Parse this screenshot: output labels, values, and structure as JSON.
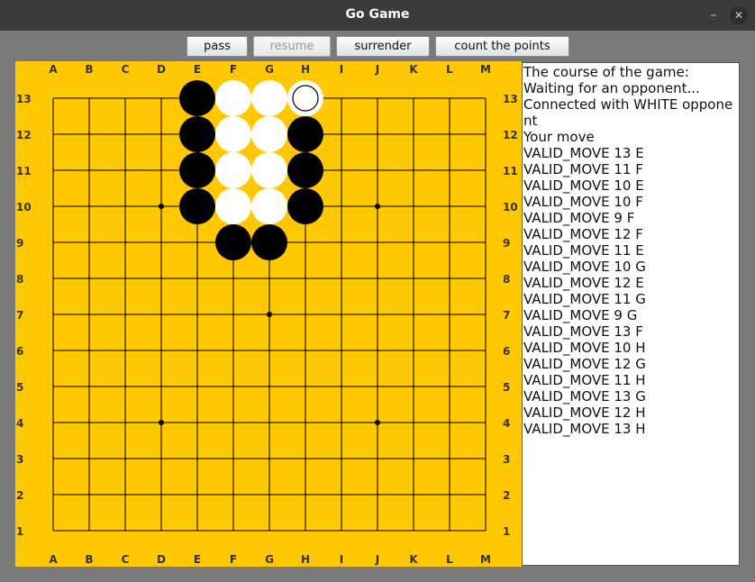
{
  "window": {
    "title": "Go Game"
  },
  "controls": {
    "pass": "pass",
    "resume": "resume",
    "surrender": "surrender",
    "count": "count the points"
  },
  "board": {
    "size": 13,
    "columns": [
      "A",
      "B",
      "C",
      "D",
      "E",
      "F",
      "G",
      "H",
      "I",
      "J",
      "K",
      "L",
      "M"
    ],
    "rows": [
      "13",
      "12",
      "11",
      "10",
      "9",
      "8",
      "7",
      "6",
      "5",
      "4",
      "3",
      "2",
      "1"
    ],
    "star_points": [
      "D10",
      "J10",
      "G7",
      "D4",
      "J4"
    ],
    "background_color": "#ffc800",
    "black_stones": [
      "E13",
      "E12",
      "E11",
      "E10",
      "H12",
      "H11",
      "H10",
      "F9",
      "G9"
    ],
    "white_stones": [
      "F13",
      "G13",
      "F12",
      "G12",
      "F11",
      "G11",
      "F10",
      "G10",
      "H13"
    ],
    "last_move": "H13"
  },
  "log": {
    "title": "The course of the game:",
    "lines": [
      "Waiting for an opponent...",
      "Connected with WHITE opponent",
      "Your move",
      "VALID_MOVE 13 E",
      "VALID_MOVE 11 F",
      "VALID_MOVE 10 E",
      "VALID_MOVE 10 F",
      "VALID_MOVE 9 F",
      "VALID_MOVE 12 F",
      "VALID_MOVE 11 E",
      "VALID_MOVE 10 G",
      "VALID_MOVE 12 E",
      "VALID_MOVE 11 G",
      "VALID_MOVE 9 G",
      "VALID_MOVE 13 F",
      "VALID_MOVE 10 H",
      "VALID_MOVE 12 G",
      "VALID_MOVE 11 H",
      "VALID_MOVE 13 G",
      "VALID_MOVE 12 H",
      "VALID_MOVE 13 H"
    ]
  }
}
